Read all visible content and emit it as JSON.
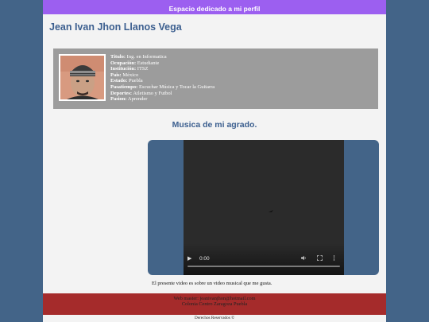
{
  "header": {
    "title": "Espacio dedicado a mi perfil"
  },
  "profile": {
    "name": "Jean Ivan Jhon Llanos Vega",
    "fields": [
      {
        "label": "Titulo:",
        "value": "Ing. en Informatica"
      },
      {
        "label": "Ocupación:",
        "value": "Estudiante"
      },
      {
        "label": "Institución:",
        "value": "ITSZ"
      },
      {
        "label": "Pais:",
        "value": "México"
      },
      {
        "label": "Estado:",
        "value": "Puebla"
      },
      {
        "label": "Pasatiempo:",
        "value": "Escuchar Música y Tocar la Guitarra"
      },
      {
        "label": "Deportes:",
        "value": "Atletismo y Futbol"
      },
      {
        "label": "Pasion:",
        "value": "Aprender"
      }
    ]
  },
  "music": {
    "title": "Musica de mi agrado.",
    "video_time": "0:00",
    "caption": "El presente video es sobre un video musical que me gusta."
  },
  "footer": {
    "webmaster": "Web master: jeanivanjhon@hotmail.com",
    "address": "Colonia Centro Zaragoza Puebla",
    "copyright": "Derechos Reservados ©"
  },
  "colors": {
    "page_bg": "#436488",
    "header_bar": "#9c5ff0",
    "profile_box": "#9c9c9c",
    "footer": "#a52b2b",
    "title_text": "#3c5f8f"
  },
  "icons": {
    "play": "play-icon",
    "volume": "volume-icon",
    "fullscreen": "fullscreen-icon",
    "more": "more-options-icon"
  }
}
